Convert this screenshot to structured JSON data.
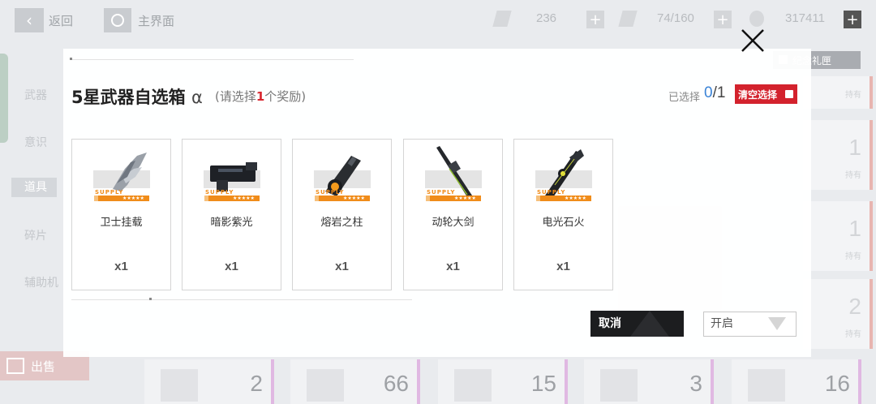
{
  "header": {
    "back_label": "返回",
    "home_label": "主界面",
    "resource1": "236",
    "resource2": "74/160",
    "resource3": "317411"
  },
  "sidebar": {
    "items": [
      "武器",
      "意识",
      "道具",
      "碎片",
      "辅助机"
    ],
    "sell_label": "出售"
  },
  "memorial_label": "纪念礼匣",
  "background_cards": {
    "held_label": "持有",
    "right_values": [
      "1",
      "1",
      "2"
    ],
    "bottom_values": [
      "2",
      "66",
      "15",
      "3",
      "16"
    ]
  },
  "modal": {
    "title": "5星武器自选箱",
    "title_symbol": "α",
    "hint_prefix": "(请选择",
    "hint_count": "1",
    "hint_suffix": "个奖励)",
    "selected_label": "已选择",
    "selected_current": "0",
    "selected_total": "/1",
    "clear_label": "清空选择",
    "supply_text": "SUPPLY",
    "stars_text": "★★★★★",
    "items": [
      {
        "name": "卫士挂载",
        "qty": "x1"
      },
      {
        "name": "暗影紫光",
        "qty": "x1"
      },
      {
        "name": "熔岩之柱",
        "qty": "x1"
      },
      {
        "name": "动轮大剑",
        "qty": "x1"
      },
      {
        "name": "电光石火",
        "qty": "x1"
      }
    ],
    "cancel_label": "取消",
    "open_label": "开启"
  },
  "colors": {
    "accent_red": "#d3222d",
    "supply_orange": "#f08c1a",
    "selected_blue": "#3a83d6"
  }
}
